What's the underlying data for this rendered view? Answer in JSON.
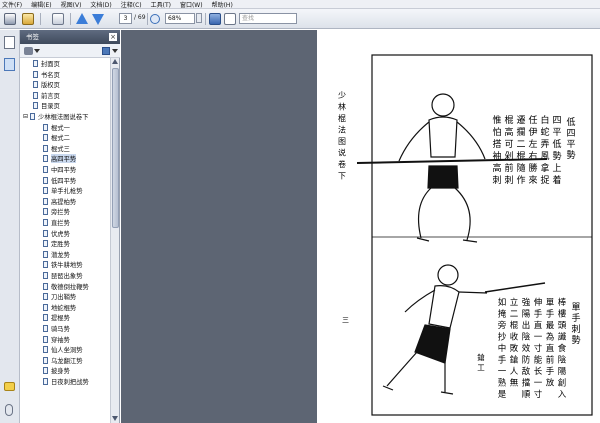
{
  "menu": [
    "文件(F)",
    "编辑(E)",
    "视图(V)",
    "文档(D)",
    "注释(C)",
    "工具(T)",
    "窗口(W)",
    "帮助(H)"
  ],
  "toolbar": {
    "current_page": "3",
    "total_pages": "/ 69",
    "zoom": "68%",
    "search_placeholder": "查找"
  },
  "bookmarks": {
    "title": "书签",
    "close": "×",
    "items": [
      {
        "label": "封面页",
        "level": 1
      },
      {
        "label": "书名页",
        "level": 1
      },
      {
        "label": "版权页",
        "level": 1
      },
      {
        "label": "前言页",
        "level": 1
      },
      {
        "label": "目录页",
        "level": 1
      },
      {
        "label": "少林棍法图说卷下",
        "level": 0,
        "expander": "⊟"
      },
      {
        "label": "棍式一",
        "level": 2
      },
      {
        "label": "棍式二",
        "level": 2
      },
      {
        "label": "棍式三",
        "level": 2
      },
      {
        "label": "高四平势",
        "level": 2,
        "selected": true
      },
      {
        "label": "中四平势",
        "level": 2
      },
      {
        "label": "低四平势",
        "level": 2
      },
      {
        "label": "单手扎枪势",
        "level": 2
      },
      {
        "label": "高提柏势",
        "level": 2
      },
      {
        "label": "旁拦势",
        "level": 2
      },
      {
        "label": "直拦势",
        "level": 2
      },
      {
        "label": "伏虎势",
        "level": 2
      },
      {
        "label": "定胜势",
        "level": 2
      },
      {
        "label": "潜龙势",
        "level": 2
      },
      {
        "label": "铁牛耕地势",
        "level": 2
      },
      {
        "label": "琵琶出象势",
        "level": 2
      },
      {
        "label": "敬德倒拉鞭势",
        "level": 2
      },
      {
        "label": "刀出鞘势",
        "level": 2
      },
      {
        "label": "地蛇棍势",
        "level": 2
      },
      {
        "label": "提棍势",
        "level": 2
      },
      {
        "label": "骑马势",
        "level": 2
      },
      {
        "label": "穿袖势",
        "level": 2
      },
      {
        "label": "仙人坐洞势",
        "level": 2
      },
      {
        "label": "乌龙翻江势",
        "level": 2
      },
      {
        "label": "披身势",
        "level": 2
      },
      {
        "label": "日夜刺把战势",
        "level": 2
      }
    ]
  },
  "page_content": {
    "header_col": [
      "少",
      "林",
      "棍",
      "法",
      "图",
      "说",
      "卷",
      "下"
    ],
    "page_mark": "三",
    "upper_title": "低四平勢",
    "upper_text_cols": [
      "四平低勢上着",
      "白蛇弄風拿捉",
      "任伊左右勝來",
      "遷攔二棍隨作",
      "棍高可剁前刺",
      "惟怕搭袖高刺"
    ],
    "lower_title": "單手刺勢",
    "lower_text_cols": [
      "棒樓頭讖食陰陽創入",
      "單手最為直前手放",
      "伸手直一寸能长一寸",
      "強陽出陰效防敌擋順",
      "立二棍收敗鎗人無",
      "如掩旁抄中手一熟是"
    ],
    "lower_caption": "鎗工"
  },
  "colors": {
    "doc_bg": "#5d6573",
    "panel_header": "#4a566a",
    "selection": "#c9d8ee"
  }
}
